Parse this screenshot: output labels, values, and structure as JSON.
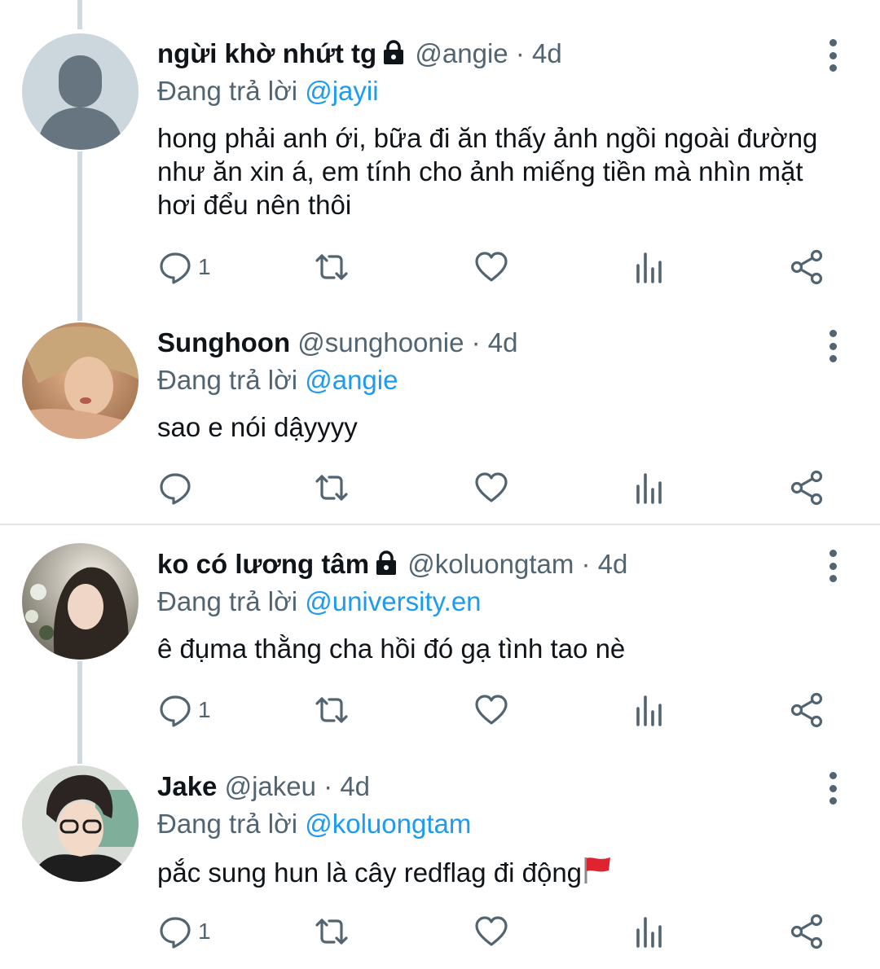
{
  "tweets": [
    {
      "name": "ngừi khờ nhứt tg",
      "locked": true,
      "handle": "@angie",
      "separator": "·",
      "time": "4d",
      "reply_prefix": "Đang trả lời",
      "reply_to": "@jayii",
      "text": "hong phải anh ới, bữa đi ăn thấy ảnh ngồi ngoài đường như ăn xin á, em tính cho ảnh miếng tiền mà nhìn mặt hơi đểu nên thôi",
      "reply_count": "1"
    },
    {
      "name": "Sunghoon",
      "locked": false,
      "handle": "@sunghoonie",
      "separator": "·",
      "time": "4d",
      "reply_prefix": "Đang trả lời",
      "reply_to": "@angie",
      "text": "sao e nói dậyyyy",
      "reply_count": ""
    },
    {
      "name": "ko có lương tâm",
      "locked": true,
      "handle": "@koluongtam",
      "separator": "·",
      "time": "4d",
      "reply_prefix": "Đang trả lời",
      "reply_to": "@university.en",
      "text": "ê đụma thằng cha hồi đó gạ tình tao nè",
      "reply_count": "1"
    },
    {
      "name": "Jake",
      "locked": false,
      "handle": "@jakeu",
      "separator": "·",
      "time": "4d",
      "reply_prefix": "Đang trả lời",
      "reply_to": "@koluongtam",
      "text": "pắc sung hun là cây redflag đi động",
      "reply_count": "1"
    }
  ],
  "icons": {
    "reply": "reply-icon",
    "retweet": "retweet-icon",
    "like": "heart-icon",
    "views": "views-chart-icon",
    "share": "share-icon",
    "lock": "lock-icon",
    "more": "more-vertical-icon",
    "flag": "red-flag-emoji"
  },
  "colors": {
    "mention": "#1d9bf0",
    "secondary_text": "#536471",
    "thread_line": "#cfd9de"
  }
}
